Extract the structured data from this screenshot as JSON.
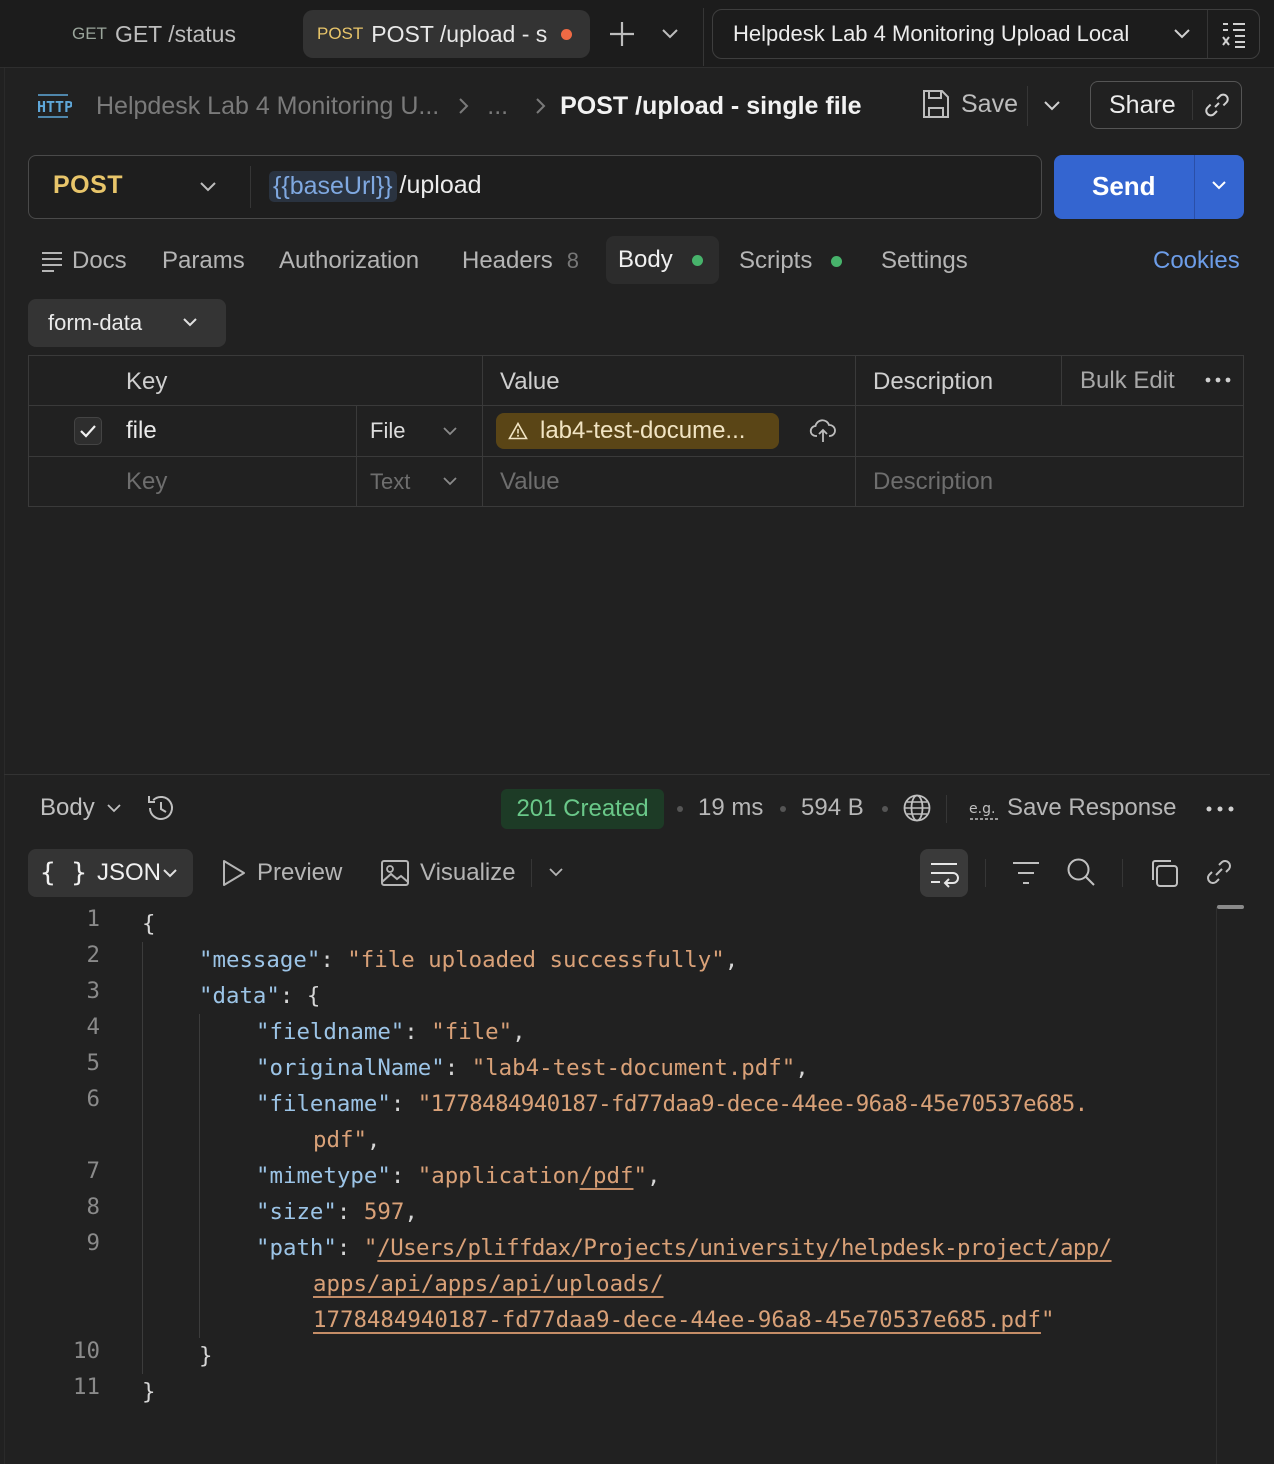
{
  "tabs": [
    {
      "method": "GET",
      "label": "GET /status"
    },
    {
      "method": "POST",
      "label": "POST /upload - s"
    }
  ],
  "environment": "Helpdesk Lab 4 Monitoring Upload Local",
  "breadcrumb": {
    "collection": "Helpdesk Lab 4 Monitoring U...",
    "ellipsis": "...",
    "title": "POST /upload - single file"
  },
  "header_actions": {
    "save": "Save",
    "share": "Share"
  },
  "request": {
    "method": "POST",
    "url_var": "{{baseUrl}}",
    "url_path": "/upload",
    "send": "Send"
  },
  "request_tabs": {
    "docs": "Docs",
    "params": "Params",
    "authorization": "Authorization",
    "headers": "Headers",
    "headers_count": "8",
    "body": "Body",
    "scripts": "Scripts",
    "settings": "Settings",
    "cookies": "Cookies"
  },
  "body_mode": "form-data",
  "table": {
    "headers": {
      "key": "Key",
      "value": "Value",
      "description": "Description",
      "bulk_edit": "Bulk Edit"
    },
    "rows": [
      {
        "checked": true,
        "key": "file",
        "type": "File",
        "value": "lab4-test-docume...",
        "description": ""
      }
    ],
    "new_row": {
      "key": "Key",
      "type": "Text",
      "value": "Value",
      "description": "Description"
    }
  },
  "response": {
    "view": "Body",
    "status": "201 Created",
    "time": "19 ms",
    "size": "594 B",
    "save_response": "Save Response",
    "formats": {
      "json": "JSON",
      "preview": "Preview",
      "visualize": "Visualize"
    },
    "line_numbers": [
      "1",
      "2",
      "3",
      "4",
      "5",
      "6",
      "7",
      "8",
      "9",
      "10",
      "11"
    ],
    "json": {
      "message_key": "\"message\"",
      "message_val": "\"file uploaded successfully\"",
      "data_key": "\"data\"",
      "fieldname_key": "\"fieldname\"",
      "fieldname_val": "\"file\"",
      "originalName_key": "\"originalName\"",
      "originalName_val": "\"lab4-test-document.pdf\"",
      "filename_key": "\"filename\"",
      "filename_val_1": "\"1778484940187-fd77daa9-dece-44ee-96a8-45e70537e685.",
      "filename_val_2": "pdf\"",
      "mimetype_key": "\"mimetype\"",
      "mimetype_val_a": "\"application",
      "mimetype_val_b": "/pdf",
      "mimetype_val_c": "\"",
      "size_key": "\"size\"",
      "size_val": "597",
      "path_key": "\"path\"",
      "path_q": "\"",
      "path_1": "/Users/pliffdax/Projects/university/helpdesk-project/app/",
      "path_2": "apps/api/apps/api/uploads/",
      "path_3": "1778484940187-fd77daa9-dece-44ee-96a8-45e70537e685.pdf",
      "path_end": "\""
    }
  }
}
